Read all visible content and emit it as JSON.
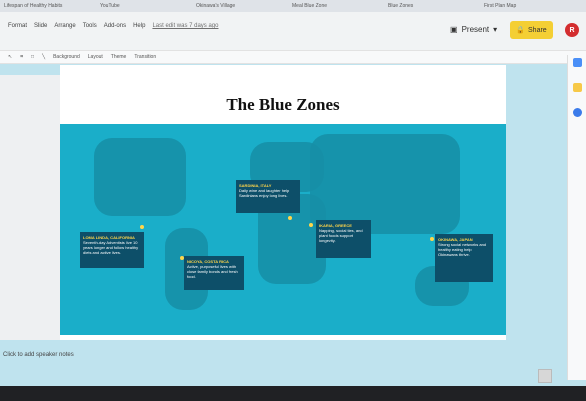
{
  "tabs": [
    "Lifespan of Healthy Habits",
    "YouTube",
    "Okinawa's Village",
    "Meal Blue Zone",
    "Blue Zones",
    "First Plan Map"
  ],
  "menu": [
    "Format",
    "Slide",
    "Arrange",
    "Tools",
    "Add-ons",
    "Help"
  ],
  "last_edit": "Last edit was 7 days ago",
  "toolbar": [
    "Background",
    "Layout",
    "Theme",
    "Transition"
  ],
  "present_label": "Present",
  "share_label": "Share",
  "avatar_initial": "R",
  "slide": {
    "title": "The Blue Zones",
    "callouts": [
      {
        "name": "LOMA LINDA, CALIFORNIA",
        "text": "Seventh-day Adventists live 10 years longer and follow healthy diets and active lives."
      },
      {
        "name": "SARDINIA, ITALY",
        "text": "Daily wine and laughter help Sardinians enjoy long lives."
      },
      {
        "name": "NICOYA, COSTA RICA",
        "text": "Active, purposeful lives with close family bonds and fresh food."
      },
      {
        "name": "IKARIA, GREECE",
        "text": "Napping, social ties, and plant foods support longevity."
      },
      {
        "name": "OKINAWA, JAPAN",
        "text": "Strong social networks and healthy eating help Okinawans thrive."
      }
    ]
  },
  "speaker_notes": "Click to add speaker notes"
}
